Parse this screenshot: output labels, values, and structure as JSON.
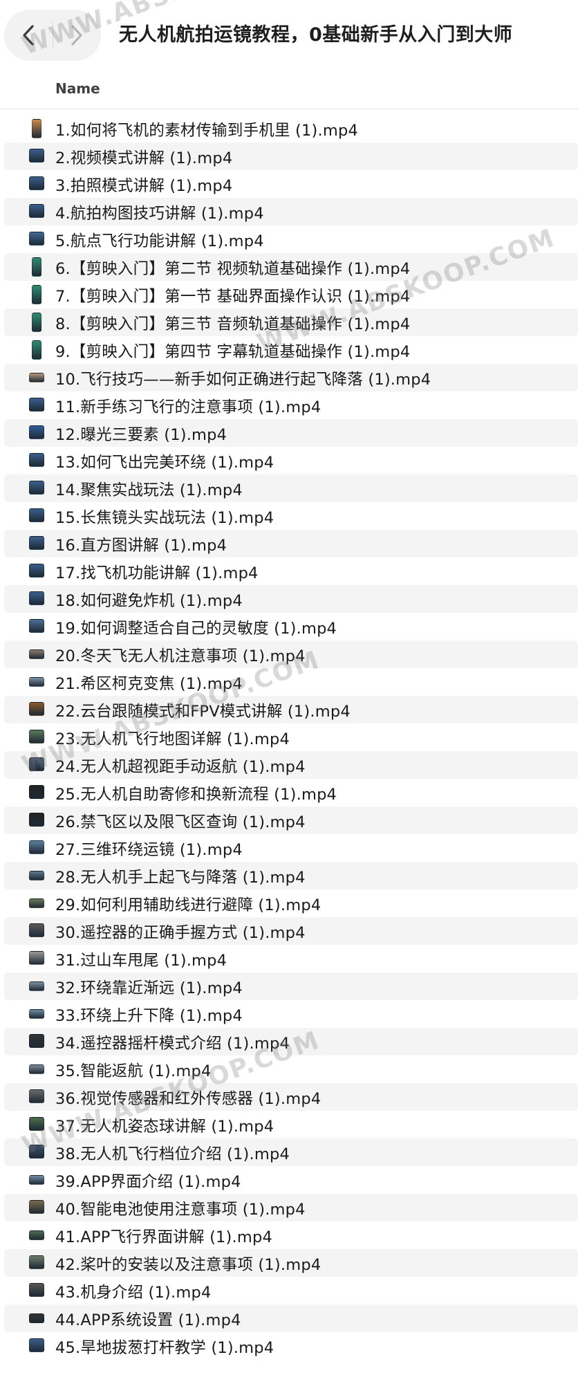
{
  "window": {
    "title": "无人机航拍运镜教程，0基础新手从入门到大师"
  },
  "nav": {
    "back_icon": "chevron-left",
    "forward_icon": "chevron-right"
  },
  "columns": {
    "name": "Name"
  },
  "watermark": {
    "text": "WWW.ABSKOOP.COM"
  },
  "files": [
    {
      "name": "1.如何将飞机的素材传输到手机里 (1).mp4",
      "thumb": "phone",
      "color": "#c9894d"
    },
    {
      "name": "2.视频模式讲解 (1).mp4",
      "thumb": "landscape",
      "color": "#3a5f8a"
    },
    {
      "name": "3.拍照模式讲解 (1).mp4",
      "thumb": "landscape",
      "color": "#3a5f8a"
    },
    {
      "name": "4.航拍构图技巧讲解 (1).mp4",
      "thumb": "landscape",
      "color": "#3a5f8a"
    },
    {
      "name": "5.航点飞行功能讲解 (1).mp4",
      "thumb": "landscape",
      "color": "#3f6a93"
    },
    {
      "name": "6.【剪映入门】第二节 视频轨道基础操作 (1).mp4",
      "thumb": "phone",
      "color": "#2f8c72"
    },
    {
      "name": "7.【剪映入门】第一节 基础界面操作认识 (1).mp4",
      "thumb": "phone",
      "color": "#2f8c72"
    },
    {
      "name": "8.【剪映入门】第三节 音频轨道基础操作 (1).mp4",
      "thumb": "phone",
      "color": "#2f8c72"
    },
    {
      "name": "9.【剪映入门】第四节 字幕轨道基础操作 (1).mp4",
      "thumb": "phone",
      "color": "#2f8c72"
    },
    {
      "name": "10.飞行技巧——新手如何正确进行起飞降落 (1).mp4",
      "thumb": "wide",
      "color": "#b59a7d"
    },
    {
      "name": "11.新手练习飞行的注意事项 (1).mp4",
      "thumb": "landscape",
      "color": "#3a5f8a"
    },
    {
      "name": "12.曝光三要素 (1).mp4",
      "thumb": "landscape",
      "color": "#2e5e99"
    },
    {
      "name": "13.如何飞出完美环绕 (1).mp4",
      "thumb": "landscape",
      "color": "#3a5f8a"
    },
    {
      "name": "14.聚焦实战玩法 (1).mp4",
      "thumb": "landscape",
      "color": "#3a5f8a"
    },
    {
      "name": "15.长焦镜头实战玩法 (1).mp4",
      "thumb": "landscape",
      "color": "#3a5f8a"
    },
    {
      "name": "16.直方图讲解 (1).mp4",
      "thumb": "landscape",
      "color": "#3a5f8a"
    },
    {
      "name": "17.找飞机功能讲解 (1).mp4",
      "thumb": "landscape",
      "color": "#3a5f8a"
    },
    {
      "name": "18.如何避免炸机 (1).mp4",
      "thumb": "landscape",
      "color": "#3a5f8a"
    },
    {
      "name": "19.如何调整适合自己的灵敏度 (1).mp4",
      "thumb": "landscape",
      "color": "#4a6f95"
    },
    {
      "name": "20.冬天飞无人机注意事项 (1).mp4",
      "thumb": "wide",
      "color": "#8c7b6a"
    },
    {
      "name": "21.希区柯克变焦 (1).mp4",
      "thumb": "wide",
      "color": "#7f93a6"
    },
    {
      "name": "22.云台跟随模式和FPV模式讲解 (1).mp4",
      "thumb": "landscape",
      "color": "#8a5a2e"
    },
    {
      "name": "23.无人机飞行地图详解 (1).mp4",
      "thumb": "landscape",
      "color": "#5c7a5a"
    },
    {
      "name": "24.无人机超视距手动返航 (1).mp4",
      "thumb": "landscape",
      "color": "#4a5f75"
    },
    {
      "name": "25.无人机自助寄修和换新流程 (1).mp4",
      "thumb": "landscape",
      "color": "#222222"
    },
    {
      "name": "26.禁飞区以及限飞区查询 (1).mp4",
      "thumb": "landscape",
      "color": "#222222"
    },
    {
      "name": "27.三维环绕运镜 (1).mp4",
      "thumb": "landscape",
      "color": "#5b7fa0"
    },
    {
      "name": "28.无人机手上起飞与降落 (1).mp4",
      "thumb": "wide",
      "color": "#5c7a8e"
    },
    {
      "name": "29.如何利用辅助线进行避障 (1).mp4",
      "thumb": "wide",
      "color": "#6a7d5a"
    },
    {
      "name": "30.遥控器的正确手握方式 (1).mp4",
      "thumb": "landscape",
      "color": "#5a5a5a"
    },
    {
      "name": "31.过山车甩尾 (1).mp4",
      "thumb": "landscape",
      "color": "#9a9a9a"
    },
    {
      "name": "32.环绕靠近渐远 (1).mp4",
      "thumb": "wide",
      "color": "#7d90a2"
    },
    {
      "name": "33.环绕上升下降 (1).mp4",
      "thumb": "wide",
      "color": "#6f8aa0"
    },
    {
      "name": "34.遥控器摇杆模式介绍 (1).mp4",
      "thumb": "landscape",
      "color": "#333333"
    },
    {
      "name": "35.智能返航 (1).mp4",
      "thumb": "wide",
      "color": "#7e8e9c"
    },
    {
      "name": "36.视觉传感器和红外传感器 (1).mp4",
      "thumb": "landscape",
      "color": "#6a6a6a"
    },
    {
      "name": "37.无人机姿态球讲解 (1).mp4",
      "thumb": "landscape",
      "color": "#4e6e4a"
    },
    {
      "name": "38.无人机飞行档位介绍 (1).mp4",
      "thumb": "landscape",
      "color": "#3a4f6a"
    },
    {
      "name": "39.APP界面介绍 (1).mp4",
      "thumb": "wide",
      "color": "#6f8ea8"
    },
    {
      "name": "40.智能电池使用注意事项 (1).mp4",
      "thumb": "landscape",
      "color": "#7a6a4e"
    },
    {
      "name": "41.APP飞行界面讲解 (1).mp4",
      "thumb": "wide",
      "color": "#4f6a52"
    },
    {
      "name": "42.桨叶的安装以及注意事项 (1).mp4",
      "thumb": "landscape",
      "color": "#6e7e6a"
    },
    {
      "name": "43.机身介绍 (1).mp4",
      "thumb": "landscape",
      "color": "#555555"
    },
    {
      "name": "44.APP系统设置 (1).mp4",
      "thumb": "wide",
      "color": "#333333"
    },
    {
      "name": "45.旱地拔葱打杆教学 (1).mp4",
      "thumb": "landscape",
      "color": "#3a5f8a"
    }
  ]
}
